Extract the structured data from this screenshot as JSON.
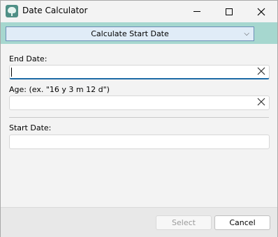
{
  "window": {
    "title": "Date Calculator"
  },
  "mode_select": {
    "value": "Calculate Start Date"
  },
  "fields": {
    "end_date": {
      "label": "End Date:",
      "value": ""
    },
    "age": {
      "label": "Age: (ex. \"16 y 3 m 12 d\")",
      "value": ""
    },
    "start_date": {
      "label": "Start Date:",
      "value": ""
    }
  },
  "buttons": {
    "select": "Select",
    "cancel": "Cancel"
  },
  "icons": {
    "app": "tree-icon",
    "minimize": "minimize-icon",
    "maximize": "maximize-icon",
    "close": "close-icon",
    "chevron": "chevron-down-icon",
    "clear": "clear-x-icon"
  },
  "colors": {
    "banner": "#a6d7cf",
    "focus": "#1b6aa5"
  }
}
